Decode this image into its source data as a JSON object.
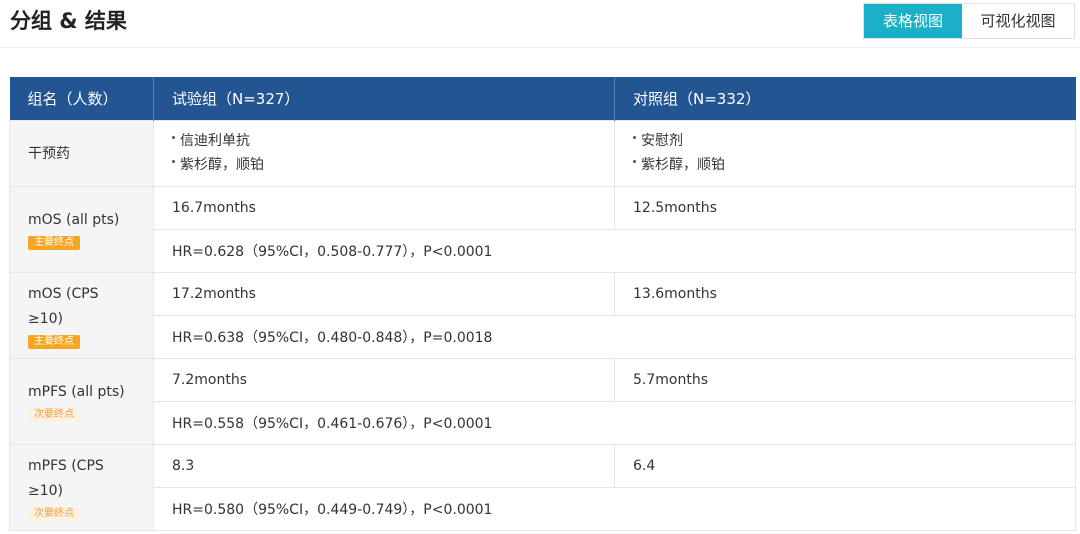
{
  "header": {
    "title": "分组 & 结果",
    "toggle": {
      "table_view": "表格视图",
      "visual_view": "可视化视图"
    }
  },
  "table": {
    "columns": [
      "组名（人数）",
      "试验组（N=327）",
      "对照组（N=332）"
    ],
    "intervention": {
      "label": "干预药",
      "experimental": [
        "信迪利单抗",
        "紫杉醇，顺铂"
      ],
      "control": [
        "安慰剂",
        "紫杉醇，顺铂"
      ]
    },
    "endpoints": [
      {
        "label_line1": "mOS (all pts)",
        "label_line2": "",
        "badge": "主要终点",
        "badge_type": "primary",
        "experimental": "16.7months",
        "control": "12.5months",
        "hr": "HR=0.628（95%CI，0.508-0.777），P<0.0001"
      },
      {
        "label_line1": "mOS (CPS",
        "label_line2": "≥10)",
        "badge": "主要终点",
        "badge_type": "primary",
        "experimental": "17.2months",
        "control": "13.6months",
        "hr": "HR=0.638（95%CI，0.480-0.848），P=0.0018"
      },
      {
        "label_line1": "mPFS (all pts)",
        "label_line2": "",
        "badge": "次要终点",
        "badge_type": "secondary",
        "experimental": "7.2months",
        "control": "5.7months",
        "hr": "HR=0.558（95%CI，0.461-0.676），P<0.0001"
      },
      {
        "label_line1": "mPFS (CPS",
        "label_line2": "≥10)",
        "badge": "次要终点",
        "badge_type": "secondary",
        "experimental": "8.3",
        "control": "6.4",
        "hr": "HR=0.580（95%CI，0.449-0.749），P<0.0001"
      }
    ]
  },
  "colors": {
    "header_bg": "#245593",
    "toggle_active": "#1ab0c8",
    "badge_primary": "#f5a623",
    "badge_secondary_bg": "#fdf1e1"
  }
}
